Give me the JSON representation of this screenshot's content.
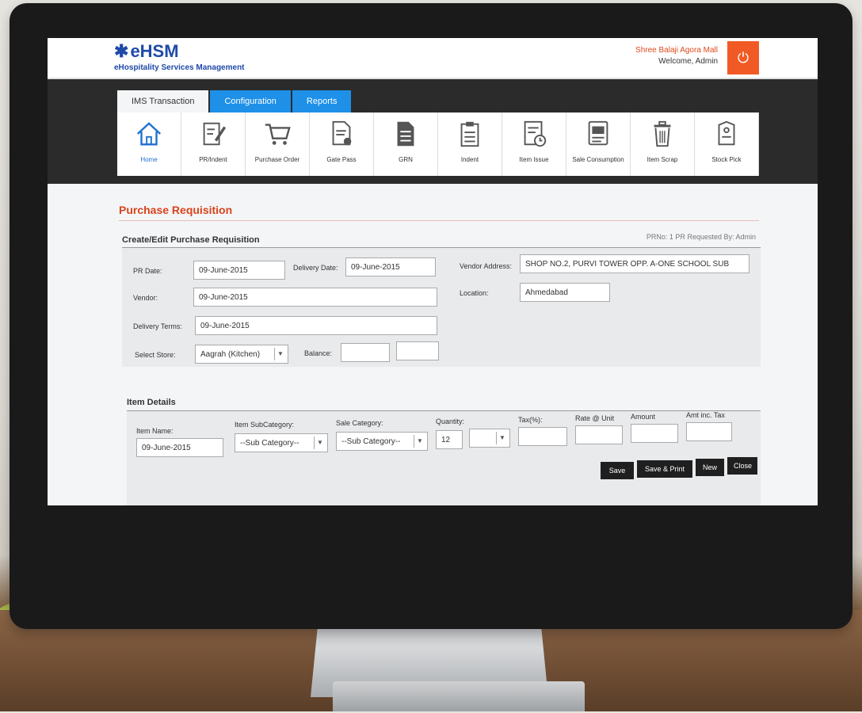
{
  "app": {
    "logo": "eHSM",
    "tagline": "eHospitality Services Management",
    "company": "Shree Balaji Agora Mall",
    "welcome": "Welcome, Admin"
  },
  "tabs": [
    {
      "label": "IMS Transaction",
      "active": true
    },
    {
      "label": "Configuration",
      "active": false
    },
    {
      "label": "Reports",
      "active": false
    }
  ],
  "toolbar": [
    {
      "label": "Home",
      "icon": "home-icon"
    },
    {
      "label": "PR/Indent",
      "icon": "edit-document-icon"
    },
    {
      "label": "Purchase Order",
      "icon": "cart-icon"
    },
    {
      "label": "Gate Pass",
      "icon": "document-search-icon"
    },
    {
      "label": "GRN",
      "icon": "document-icon"
    },
    {
      "label": "Indent",
      "icon": "clipboard-icon"
    },
    {
      "label": "Item Issue",
      "icon": "document-clock-icon"
    },
    {
      "label": "Sale Consumption",
      "icon": "report-icon"
    },
    {
      "label": "Item Scrap",
      "icon": "trash-icon"
    },
    {
      "label": "Stock Pick",
      "icon": "tag-icon"
    }
  ],
  "page": {
    "title": "Purchase Requisition",
    "section": "Create/Edit Purchase Requisition",
    "pr_info": "PRNo: 1 PR Requested By: Admin"
  },
  "form": {
    "pr_date_label": "PR Date:",
    "pr_date": "09-June-2015",
    "delivery_date_label": "Delivery Date:",
    "delivery_date": "09-June-2015",
    "vendor_address_label": "Vendor Address:",
    "vendor_address": "SHOP NO.2, PURVI TOWER OPP. A-ONE SCHOOL SUB",
    "vendor_label": "Vendor:",
    "vendor": "09-June-2015",
    "location_label": "Location:",
    "location": "Ahmedabad",
    "delivery_terms_label": "Delivery Terms:",
    "delivery_terms": "09-June-2015",
    "select_store_label": "Select Store:",
    "select_store": "Aagrah (Kitchen)",
    "balance_label": "Balance:",
    "balance_1": "",
    "balance_2": ""
  },
  "items": {
    "title": "Item Details",
    "item_name_label": "Item Name:",
    "item_name": "09-June-2015",
    "item_subcategory_label": "Item SubCategory:",
    "item_subcategory": "--Sub Category--",
    "sale_category_label": "Sale Category:",
    "sale_category": "--Sub Category--",
    "quantity_label": "Quantity:",
    "quantity": "12",
    "unit": "",
    "tax_label": "Tax(%):",
    "rate_label": "Rate @ Unit",
    "amount_label": "Amount",
    "amt_inc_tax_label": "Amt inc. Tax"
  },
  "buttons": {
    "save": "Save",
    "save_print": "Save & Print",
    "new": "New",
    "close": "Close"
  },
  "colors": {
    "brand_blue": "#1f4aa8",
    "tab_blue": "#1e90e8",
    "accent_orange": "#f15a24",
    "title_red": "#d9441c"
  }
}
